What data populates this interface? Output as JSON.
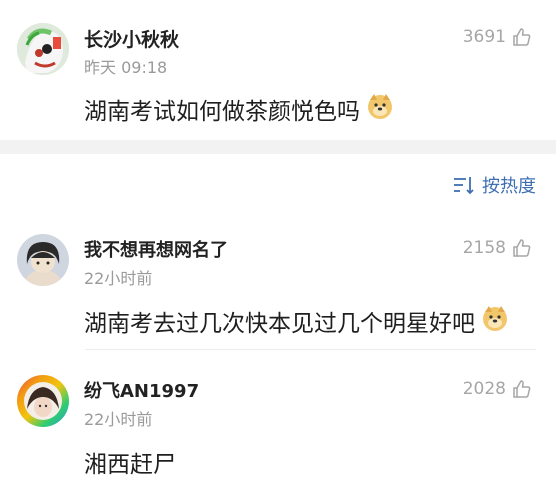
{
  "post": {
    "author": "长沙小秋秋",
    "time": "昨天 09:18",
    "likes": "3691",
    "text": "湖南考试如何做茶颜悦色吗",
    "emoji": "doge-emoji"
  },
  "sort": {
    "label": "按热度",
    "icon": "sort-icon"
  },
  "comments": [
    {
      "author": "我不想再想网名了",
      "time": "22小时前",
      "likes": "2158",
      "text": "湖南考去过几次快本见过几个明星好吧",
      "emoji": "doge-emoji"
    },
    {
      "author": "纷飞AN1997",
      "time": "22小时前",
      "likes": "2028",
      "text": "湘西赶尸"
    }
  ],
  "colors": {
    "link_blue": "#3e6fb3",
    "gray_text": "#9a9a9a",
    "band": "#f2f2f2"
  }
}
